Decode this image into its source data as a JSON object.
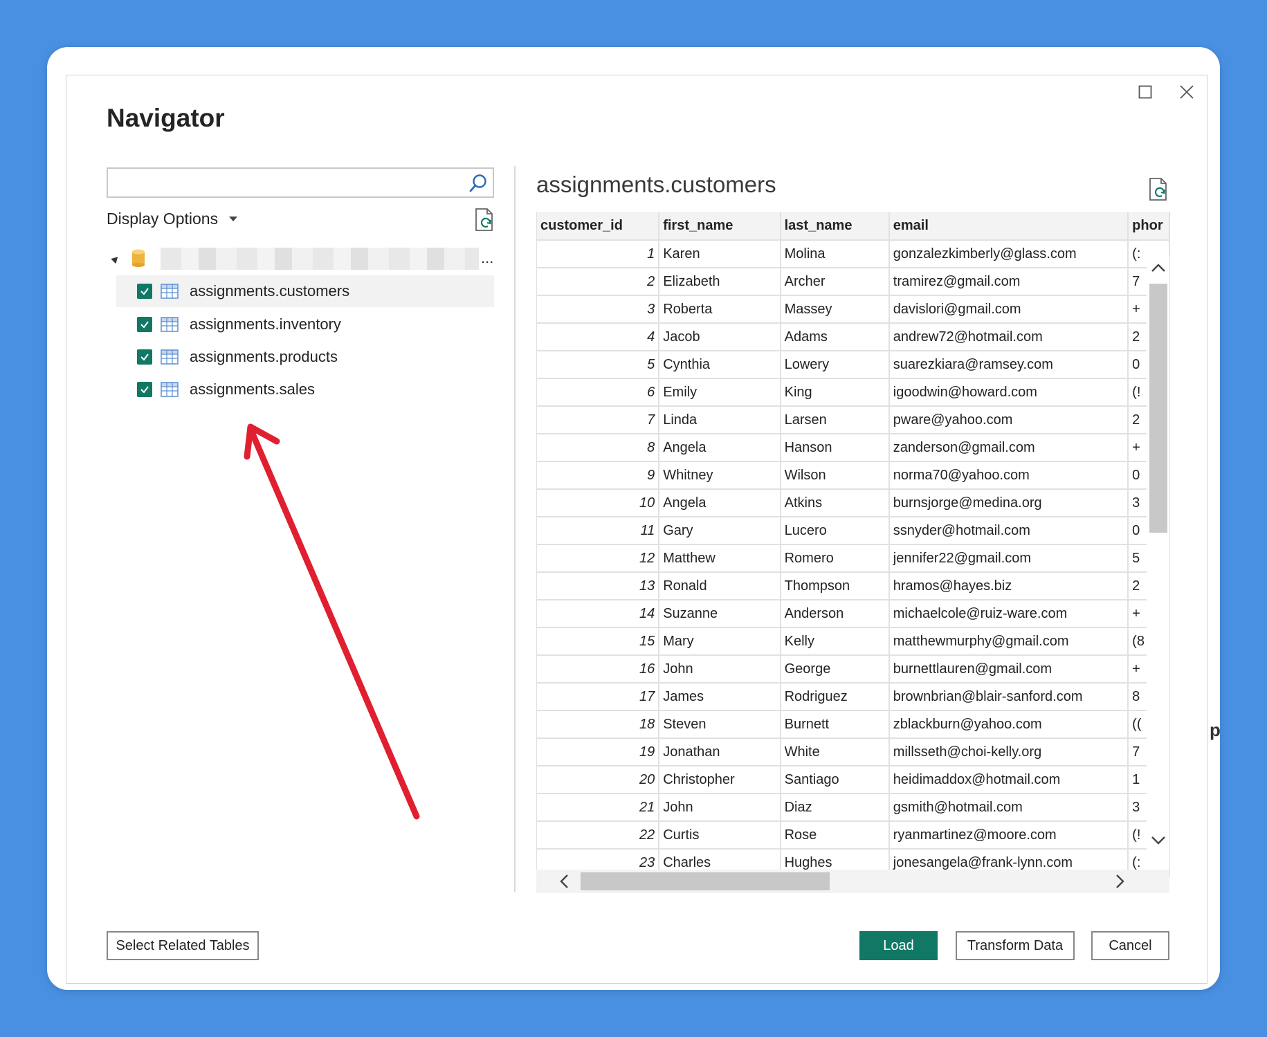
{
  "dialog": {
    "title": "Navigator",
    "colors": {
      "accent": "#117865",
      "background": "#4a90e2"
    }
  },
  "left_pane": {
    "search": {
      "value": "",
      "placeholder": ""
    },
    "display_options_label": "Display Options",
    "tree_root": {
      "ellipsis": "..."
    },
    "tables": [
      {
        "label": "assignments.customers",
        "checked": true,
        "selected": true
      },
      {
        "label": "assignments.inventory",
        "checked": true,
        "selected": false
      },
      {
        "label": "assignments.products",
        "checked": true,
        "selected": false
      },
      {
        "label": "assignments.sales",
        "checked": true,
        "selected": false
      }
    ]
  },
  "preview": {
    "title": "assignments.customers",
    "columns": [
      "customer_id",
      "first_name",
      "last_name",
      "email",
      "phor"
    ],
    "rows": [
      [
        "1",
        "Karen",
        "Molina",
        "gonzalezkimberly@glass.com",
        "(:"
      ],
      [
        "2",
        "Elizabeth",
        "Archer",
        "tramirez@gmail.com",
        "7"
      ],
      [
        "3",
        "Roberta",
        "Massey",
        "davislori@gmail.com",
        "+"
      ],
      [
        "4",
        "Jacob",
        "Adams",
        "andrew72@hotmail.com",
        "2"
      ],
      [
        "5",
        "Cynthia",
        "Lowery",
        "suarezkiara@ramsey.com",
        "0"
      ],
      [
        "6",
        "Emily",
        "King",
        "igoodwin@howard.com",
        "(!"
      ],
      [
        "7",
        "Linda",
        "Larsen",
        "pware@yahoo.com",
        "2"
      ],
      [
        "8",
        "Angela",
        "Hanson",
        "zanderson@gmail.com",
        "+"
      ],
      [
        "9",
        "Whitney",
        "Wilson",
        "norma70@yahoo.com",
        "0"
      ],
      [
        "10",
        "Angela",
        "Atkins",
        "burnsjorge@medina.org",
        "3"
      ],
      [
        "11",
        "Gary",
        "Lucero",
        "ssnyder@hotmail.com",
        "0"
      ],
      [
        "12",
        "Matthew",
        "Romero",
        "jennifer22@gmail.com",
        "5"
      ],
      [
        "13",
        "Ronald",
        "Thompson",
        "hramos@hayes.biz",
        "2"
      ],
      [
        "14",
        "Suzanne",
        "Anderson",
        "michaelcole@ruiz-ware.com",
        "+"
      ],
      [
        "15",
        "Mary",
        "Kelly",
        "matthewmurphy@gmail.com",
        "(8"
      ],
      [
        "16",
        "John",
        "George",
        "burnettlauren@gmail.com",
        "+"
      ],
      [
        "17",
        "James",
        "Rodriguez",
        "brownbrian@blair-sanford.com",
        "8"
      ],
      [
        "18",
        "Steven",
        "Burnett",
        "zblackburn@yahoo.com",
        "(("
      ],
      [
        "19",
        "Jonathan",
        "White",
        "millsseth@choi-kelly.org",
        "7"
      ],
      [
        "20",
        "Christopher",
        "Santiago",
        "heidimaddox@hotmail.com",
        "1"
      ],
      [
        "21",
        "John",
        "Diaz",
        "gsmith@hotmail.com",
        "3"
      ],
      [
        "22",
        "Curtis",
        "Rose",
        "ryanmartinez@moore.com",
        "(!"
      ],
      [
        "23",
        "Charles",
        "Hughes",
        "jonesangela@frank-lynn.com",
        "(:"
      ]
    ]
  },
  "footer": {
    "select_related_label": "Select Related Tables",
    "load_label": "Load",
    "transform_label": "Transform Data",
    "cancel_label": "Cancel"
  },
  "side_peek_text": "p"
}
